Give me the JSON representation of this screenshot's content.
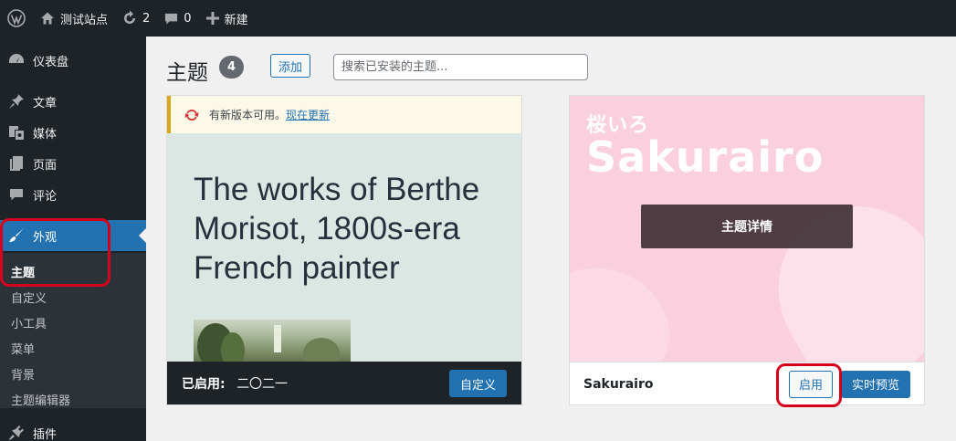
{
  "adminbar": {
    "site_name": "测试站点",
    "updates_count": "2",
    "comments_count": "0",
    "new_label": "新建"
  },
  "sidebar": {
    "items": [
      {
        "label": "仪表盘",
        "icon": "dashboard-icon"
      },
      {
        "label": "文章",
        "icon": "pin-icon"
      },
      {
        "label": "媒体",
        "icon": "media-icon"
      },
      {
        "label": "页面",
        "icon": "page-icon"
      },
      {
        "label": "评论",
        "icon": "comment-icon"
      },
      {
        "label": "外观",
        "icon": "paintbrush-icon",
        "active": true
      },
      {
        "label": "插件",
        "icon": "plugin-icon"
      }
    ],
    "submenu": [
      "主题",
      "自定义",
      "小工具",
      "菜单",
      "背景",
      "主题编辑器"
    ]
  },
  "page": {
    "title": "主题",
    "count": "4",
    "add_label": "添加",
    "search_placeholder": "搜索已安装的主题..."
  },
  "theme_active": {
    "notice_text": "有新版本可用。",
    "notice_link": "现在更新",
    "hero_text": "The works of Berthe Morisot, 1800s-era French painter",
    "status_label": "已启用:",
    "name": "二〇二一",
    "customize_label": "自定义"
  },
  "theme_sakurairo": {
    "screenshot_jp": "桜いろ",
    "screenshot_title": "Sakurairo",
    "details_label": "主题详情",
    "name": "Sakurairo",
    "activate_label": "启用",
    "preview_label": "实时预览"
  },
  "colors": {
    "admin_dark": "#1d2327",
    "accent": "#2271b1",
    "highlight_red": "#d6001c",
    "sakura_pink": "#fbd0de"
  }
}
